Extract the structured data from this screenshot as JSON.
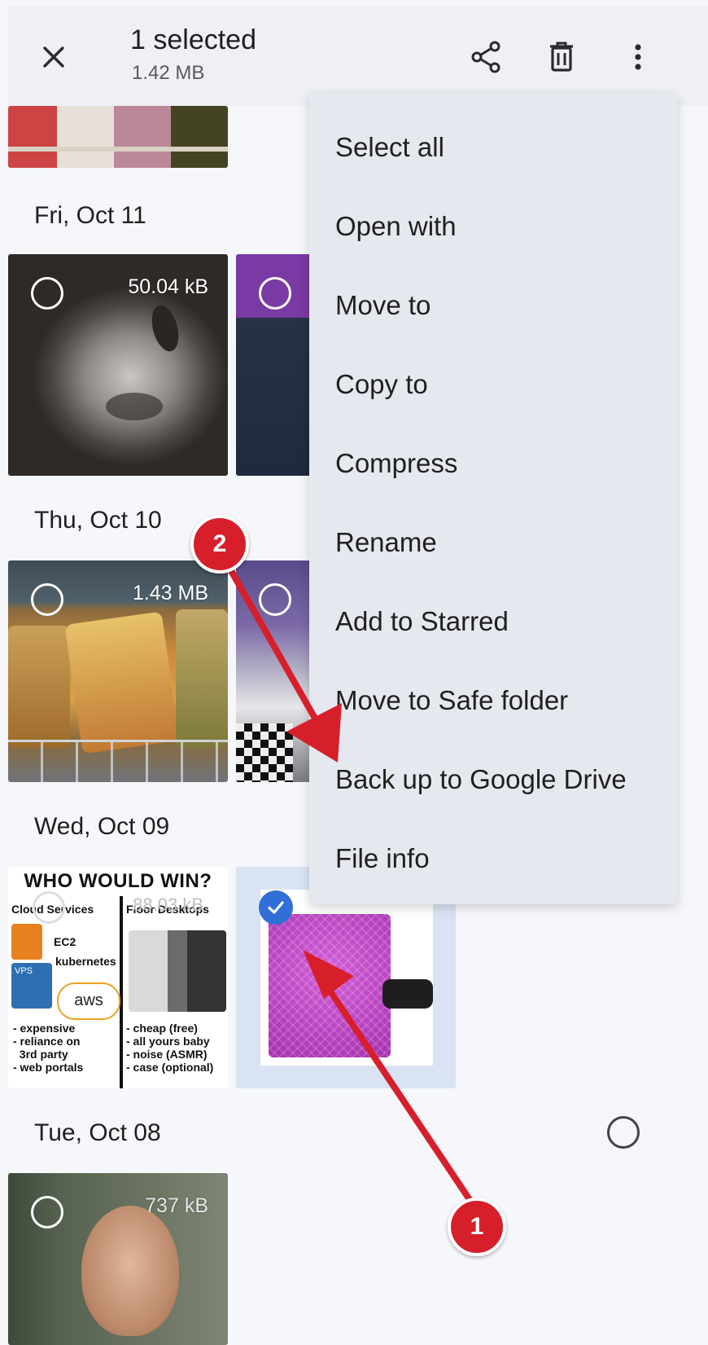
{
  "header": {
    "selection_title": "1 selected",
    "selection_size": "1.42 MB"
  },
  "dates": {
    "fri": "Fri, Oct 11",
    "thu": "Thu, Oct 10",
    "wed": "Wed, Oct 09",
    "tue": "Tue, Oct 08"
  },
  "thumbnails": {
    "cat_size": "50.04 kB",
    "pretzel_size": "1.43 MB",
    "meme_size": "88.03 kB",
    "man_size": "737 kB"
  },
  "meme": {
    "title": "WHO WOULD WIN?",
    "left_header": "Cloud Services",
    "right_header": "Floor Desktops",
    "left_labels": [
      "EC2",
      "kubernetes",
      "VPS",
      "aws"
    ],
    "left_bullets": [
      "- expensive",
      "- reliance on",
      "  3rd party",
      "- web portals"
    ],
    "right_bullets": [
      "- cheap (free)",
      "- all yours baby",
      "- noise (ASMR)",
      "- case (optional)"
    ]
  },
  "menu": {
    "items": [
      "Select all",
      "Open with",
      "Move to",
      "Copy to",
      "Compress",
      "Rename",
      "Add to Starred",
      "Move to Safe folder",
      "Back up to Google Drive",
      "File info"
    ]
  },
  "annotations": {
    "badge_1": "1",
    "badge_2": "2",
    "color": "#d71f2b"
  },
  "colors": {
    "accent": "#2f6fd6",
    "background": "#f6f7fb",
    "menu_bg": "#e6e8ef"
  },
  "icons": [
    "close-icon",
    "share-icon",
    "delete-icon",
    "more-vert-icon",
    "check-icon"
  ]
}
